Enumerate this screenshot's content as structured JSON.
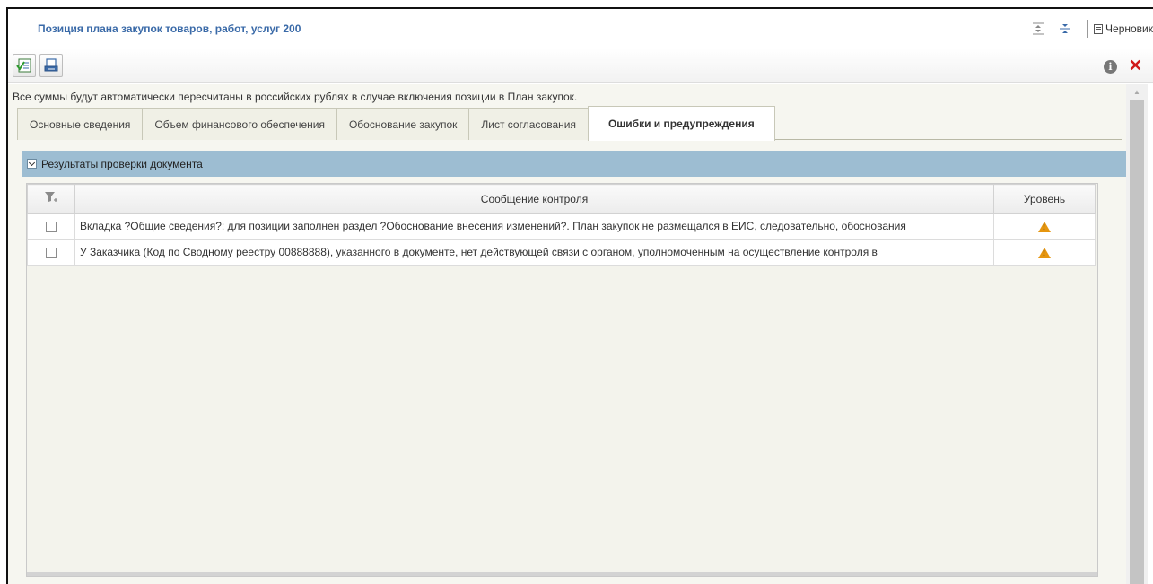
{
  "window": {
    "title": "Позиция плана закупок товаров, работ, услуг 200",
    "status_label": "Черновик"
  },
  "toolbar": {
    "tools": [
      "check-document-icon",
      "print-icon"
    ]
  },
  "notice": "Все суммы будут автоматически пересчитаны в российских рублях в случае включения позиции в План закупок.",
  "tabs": [
    {
      "label": "Основные сведения",
      "active": false
    },
    {
      "label": "Объем финансового обеспечения",
      "active": false
    },
    {
      "label": "Обоснование закупок",
      "active": false
    },
    {
      "label": "Лист согласования",
      "active": false
    },
    {
      "label": "Ошибки и предупреждения",
      "active": true
    }
  ],
  "results": {
    "group_title": "Результаты проверки документа",
    "columns": {
      "message": "Сообщение контроля",
      "level": "Уровень"
    },
    "rows": [
      {
        "message": "Вкладка ?Общие сведения?: для позиции заполнен раздел ?Обоснование внесения изменений?. План закупок не размещался в ЕИС, следовательно, обоснования",
        "level": "warning"
      },
      {
        "message": "У Заказчика (Код по Сводному реестру 00888888), указанного в документе, нет действующей связи с органом, уполномоченным на осуществление контроля в",
        "level": "warning"
      }
    ]
  },
  "colors": {
    "title": "#3a6aa8",
    "group_header": "#9dbdd2",
    "warning": "#e6960f",
    "close": "#d01919"
  }
}
